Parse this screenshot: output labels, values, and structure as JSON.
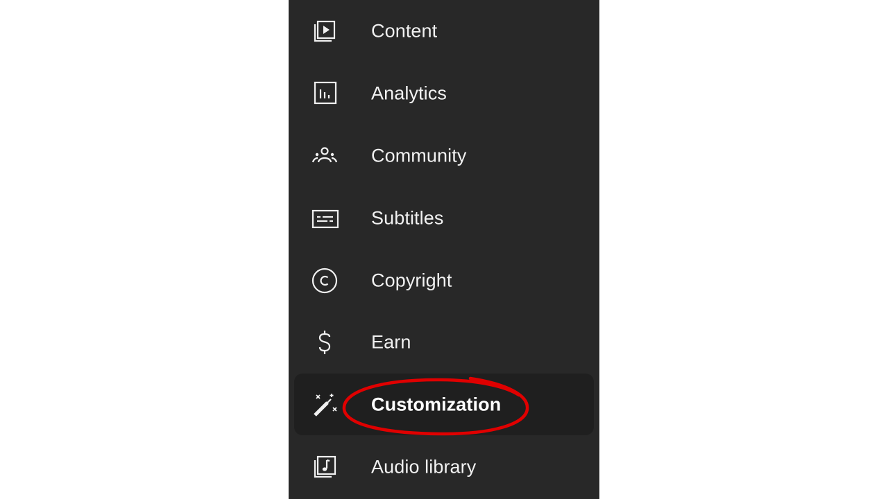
{
  "sidebar": {
    "items": [
      {
        "label": "Content",
        "icon": "video-library-icon"
      },
      {
        "label": "Analytics",
        "icon": "bar-chart-icon"
      },
      {
        "label": "Community",
        "icon": "people-icon"
      },
      {
        "label": "Subtitles",
        "icon": "subtitles-icon"
      },
      {
        "label": "Copyright",
        "icon": "copyright-icon"
      },
      {
        "label": "Earn",
        "icon": "dollar-icon"
      },
      {
        "label": "Customization",
        "icon": "magic-wand-icon",
        "active": true
      },
      {
        "label": "Audio library",
        "icon": "music-library-icon"
      }
    ]
  },
  "annotation": {
    "highlight_color": "#e00000",
    "highlighted_item": "Customization"
  },
  "colors": {
    "sidebar_background": "#282828",
    "active_background": "#1f1f1f",
    "text": "#f1f1f1",
    "page_background": "#ffffff"
  }
}
